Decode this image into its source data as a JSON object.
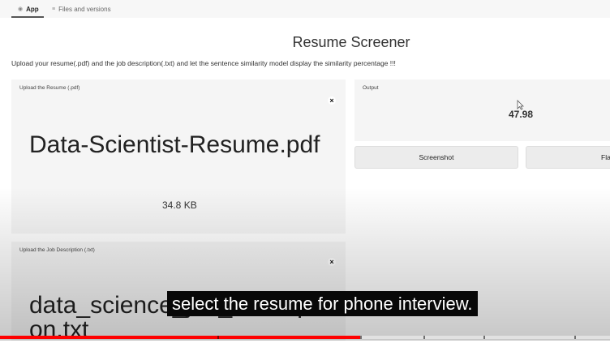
{
  "tabs": [
    {
      "label": "App",
      "icon": "app-icon"
    },
    {
      "label": "Files and versions",
      "icon": "files-icon"
    }
  ],
  "title": "Resume Screener",
  "description": "Upload your resume(.pdf) and the job description(.txt) and let the sentence similarity model display the similarity percentage !!!",
  "resume_upload": {
    "label": "Upload the Resume (.pdf)",
    "file_name": "Data-Scientist-Resume.pdf",
    "file_size": "34.8 KB"
  },
  "jd_upload": {
    "label": "Upload the Job Description (.txt)",
    "file_name": "data_science_job_description.txt"
  },
  "output": {
    "label": "Output",
    "value": "47.98"
  },
  "buttons": {
    "screenshot": "Screenshot",
    "flag": "Fla"
  },
  "video": {
    "caption": "select the resume for phone interview.",
    "progress": 0.59,
    "progress_color": "#ff0000"
  }
}
